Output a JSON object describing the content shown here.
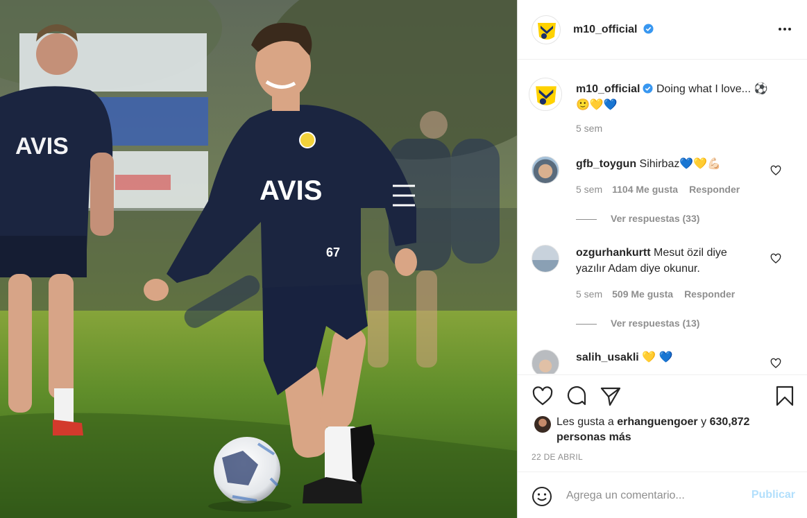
{
  "post": {
    "author": "m10_official",
    "author_verified": true,
    "photo_label": "AVIS"
  },
  "header": {
    "username": "m10_official",
    "more_icon": "more-horizontal-icon"
  },
  "caption": {
    "username": "m10_official",
    "text": "Doing what I love... ⚽️",
    "emojis": "🙂💛💙",
    "time": "5 sem"
  },
  "comments": [
    {
      "username": "gfb_toygun",
      "text": "Sihirbaz💙💛💪🏻",
      "time": "5 sem",
      "likes": "1104 Me gusta",
      "reply_label": "Responder",
      "replies_label": "Ver respuestas (33)"
    },
    {
      "username": "ozgurhankurtt",
      "text": "Mesut özil diye yazılır Adam diye okunur.",
      "time": "5 sem",
      "likes": "509 Me gusta",
      "reply_label": "Responder",
      "replies_label": "Ver respuestas (13)"
    },
    {
      "username": "salih_usakli",
      "text": "💛 💙"
    }
  ],
  "actions": {
    "like_icon": "heart-icon",
    "comment_icon": "comment-icon",
    "share_icon": "send-icon",
    "save_icon": "bookmark-icon"
  },
  "likes_summary": {
    "prefix": "Les gusta a",
    "user": "erhanguengoer",
    "joiner": "y",
    "others": "630,872 personas más"
  },
  "date": "22 DE ABRIL",
  "add_comment": {
    "placeholder": "Agrega un comentario...",
    "publish_label": "Publicar"
  },
  "colors": {
    "verified_blue": "#3897f0",
    "publish_disabled": "#b2dffc",
    "muted_text": "#8e8e8e",
    "kit_navy": "#1b2540",
    "logo_yellow": "#ffd200"
  }
}
